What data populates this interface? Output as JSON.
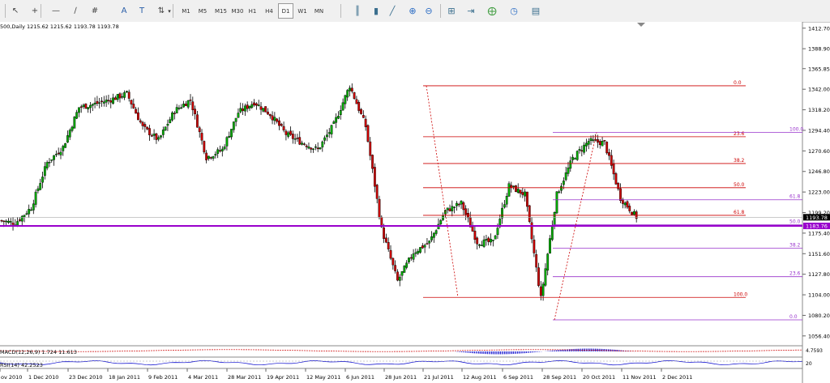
{
  "toolbar": {
    "timeframes": [
      "M1",
      "M5",
      "M15",
      "M30",
      "H1",
      "H4",
      "D1",
      "W1",
      "MN"
    ],
    "selected_timeframe": "D1",
    "tools_left": [
      "cursor-icon",
      "crosshair-icon",
      "horizontal-line-icon",
      "trendline-icon",
      "grid-icon",
      "text-icon",
      "text-label-icon",
      "arrows-icon"
    ],
    "tools_right": [
      "bar-chart-icon",
      "candlestick-icon",
      "line-chart-icon",
      "zoom-in-icon",
      "zoom-out-icon",
      "chart-grid-icon",
      "autoscroll-icon",
      "chart-shift-icon",
      "indicators-icon",
      "periods-icon",
      "templates-icon"
    ]
  },
  "chart": {
    "header": "500,Daily  1215.62 1215.62 1193.78 1193.78",
    "price_labels": [
      "1412.70",
      "1388.90",
      "1365.85",
      "1342.00",
      "1318.20",
      "1294.40",
      "1270.60",
      "1246.80",
      "1223.00",
      "1199.20",
      "1175.40",
      "1151.60",
      "1127.80",
      "1104.00",
      "1080.20",
      "1056.40"
    ],
    "current_price": "1193.78",
    "hline_price": "1183.76",
    "date_labels": [
      "ov 2010",
      "1 Dec 2010",
      "23 Dec 2010",
      "18 Jan 2011",
      "9 Feb 2011",
      "4 Mar 2011",
      "28 Mar 2011",
      "19 Apr 2011",
      "12 May 2011",
      "6 Jun 2011",
      "28 Jun 2011",
      "21 Jul 2011",
      "12 Aug 2011",
      "6 Sep 2011",
      "28 Sep 2011",
      "20 Oct 2011",
      "11 Nov 2011",
      "2 Dec 2011"
    ],
    "fib_red": {
      "labels": [
        "0.0",
        "23.6",
        "38.2",
        "50.0",
        "61.8",
        "100.0"
      ],
      "color": "#cc0000"
    },
    "fib_violet_1": {
      "labels": [
        "100.0",
        "61.8",
        "50.0"
      ],
      "color": "#9933cc"
    },
    "fib_violet_2": {
      "labels": [
        "38.2",
        "23.6",
        "0.0"
      ],
      "color": "#9933cc"
    },
    "colors": {
      "bull": "#00aa00",
      "bear": "#cc0000",
      "hline": "#9900cc",
      "macd": "#0000cc"
    },
    "macd_label": "MACD(12,26,9) 1.724 11.613",
    "macd_scale": "4.7593",
    "rsi_label": "RSI(14) 42.2523",
    "rsi_scale": "20"
  },
  "chart_data": {
    "type": "candlestick",
    "title": "500,Daily",
    "ohlc_last": {
      "open": 1215.62,
      "high": 1215.62,
      "low": 1193.78,
      "close": 1193.78
    },
    "ylim": [
      1045,
      1420
    ],
    "x": [
      "ov 2010",
      "1 Dec 2010",
      "23 Dec 2010",
      "18 Jan 2011",
      "9 Feb 2011",
      "4 Mar 2011",
      "28 Mar 2011",
      "19 Apr 2011",
      "12 May 2011",
      "6 Jun 2011",
      "28 Jun 2011",
      "21 Jul 2011",
      "12 Aug 2011",
      "6 Sep 2011",
      "28 Sep 2011",
      "20 Oct 2011",
      "11 Nov 2011",
      "2 Dec 2011"
    ],
    "close": [
      1190,
      1187,
      1205,
      1257,
      1275,
      1321,
      1325,
      1330,
      1337,
      1298,
      1283,
      1317,
      1330,
      1263,
      1272,
      1315,
      1327,
      1313,
      1290,
      1280,
      1272,
      1301,
      1346,
      1299,
      1180,
      1120,
      1153,
      1165,
      1201,
      1210,
      1165,
      1165,
      1230,
      1220,
      1100,
      1220,
      1262,
      1282,
      1280,
      1216,
      1194
    ],
    "horizontal_line": 1183.76,
    "current_price": 1193.78,
    "fibonacci_red": [
      {
        "level": "0.0",
        "price": 1346
      },
      {
        "level": "23.6",
        "price": 1287
      },
      {
        "level": "38.2",
        "price": 1256
      },
      {
        "level": "50.0",
        "price": 1228
      },
      {
        "level": "61.8",
        "price": 1196
      },
      {
        "level": "100.0",
        "price": 1101
      }
    ],
    "fibonacci_violet": [
      {
        "level": "100.0",
        "price": 1292
      },
      {
        "level": "61.8",
        "price": 1214
      },
      {
        "level": "50.0",
        "price": 1185
      },
      {
        "level": "38.2",
        "price": 1158
      },
      {
        "level": "23.6",
        "price": 1125
      },
      {
        "level": "0.0",
        "price": 1075
      }
    ],
    "indicators": [
      "MACD(12,26,9) 1.724 11.613",
      "RSI(14) 42.2523"
    ]
  }
}
